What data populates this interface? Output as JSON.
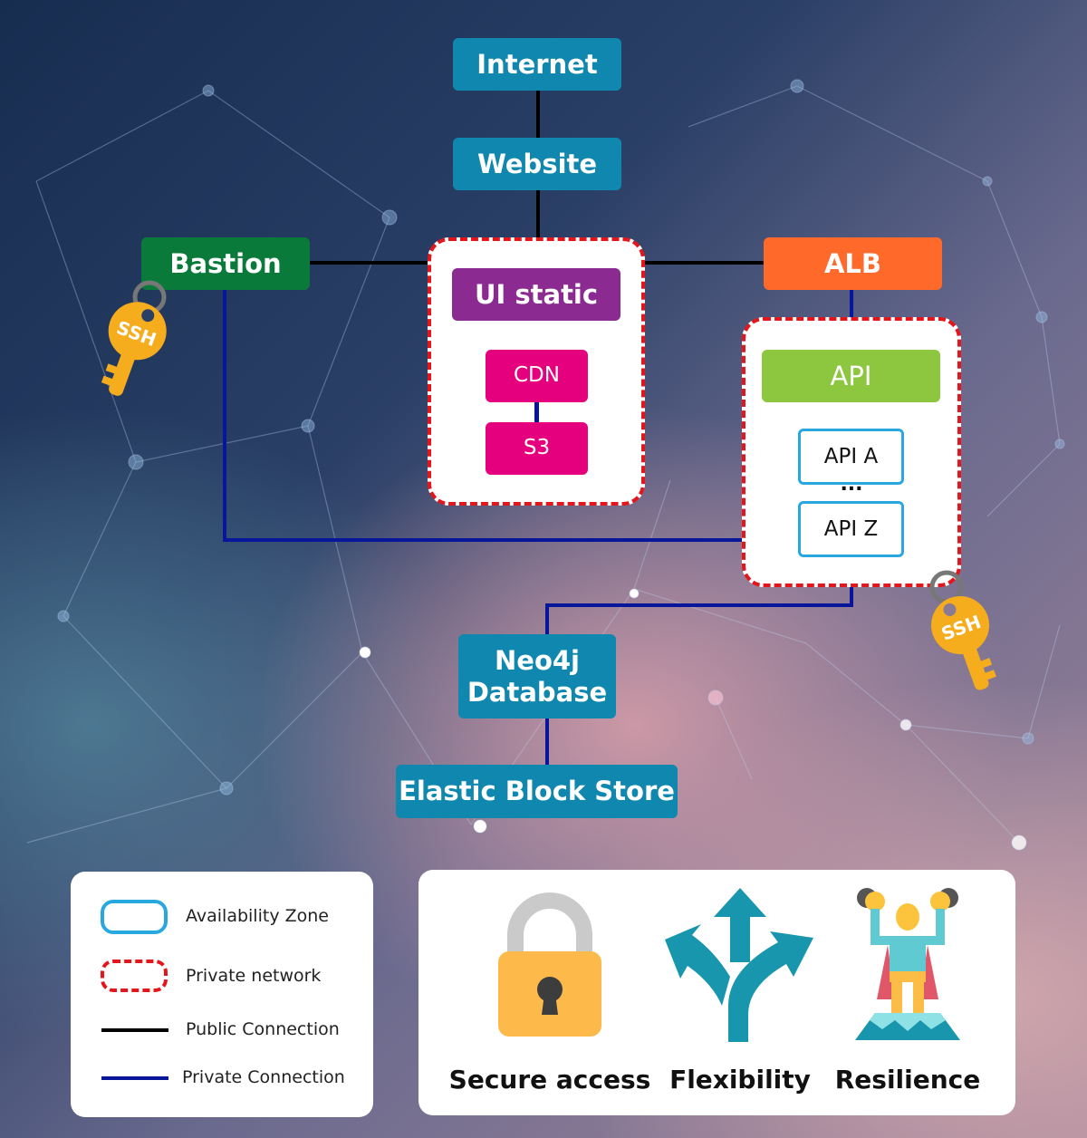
{
  "nodes": {
    "internet": "Internet",
    "website": "Website",
    "bastion": "Bastion",
    "alb": "ALB",
    "ui_static": "UI static",
    "cdn": "CDN",
    "s3": "S3",
    "api": "API",
    "api_a": "API A",
    "api_ellipsis": "...",
    "api_z": "API Z",
    "neo4j_line1": "Neo4j",
    "neo4j_line2": "Database",
    "ebs": "Elastic Block Store"
  },
  "keys": {
    "label": "SSH"
  },
  "legend": [
    {
      "label": "Availability Zone",
      "symbol": "blue-rounded-box"
    },
    {
      "label": "Private network",
      "symbol": "red-dashed-box"
    },
    {
      "label": "Public Connection",
      "symbol": "black-line"
    },
    {
      "label": "Private Connection",
      "symbol": "blue-line"
    }
  ],
  "features": [
    {
      "label": "Secure access",
      "icon": "padlock-icon"
    },
    {
      "label": "Flexibility",
      "icon": "branching-arrows-icon"
    },
    {
      "label": "Resilience",
      "icon": "strong-hero-icon"
    }
  ],
  "colors": {
    "teal": "#0f87ae",
    "bastion": "#0a7a3a",
    "alb": "#ff6a2b",
    "ui_static": "#8b2a91",
    "cdn_s3": "#e5007e",
    "api": "#8dc63f",
    "private_network": "#e4161b",
    "availability_zone": "#29a8e0",
    "public_connection": "#000000",
    "private_connection": "#08169a"
  }
}
